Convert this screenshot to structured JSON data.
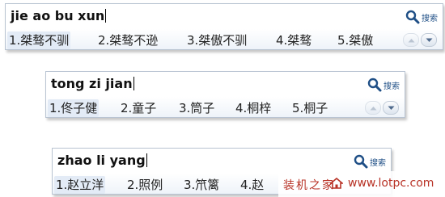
{
  "panels": [
    {
      "pinyin": "jie ao bu xun",
      "search_label": "搜索",
      "candidates": [
        "1.桀骜不驯",
        "2.桀骜不逊",
        "3.桀傲不驯",
        "4.桀骜",
        "5.桀傲"
      ]
    },
    {
      "pinyin": "tong zi jian",
      "search_label": "搜索",
      "candidates": [
        "1.佟子健",
        "2.童子",
        "3.筒子",
        "4.桐梓",
        "5.桐子"
      ]
    },
    {
      "pinyin": "zhao li yang",
      "search_label": "搜索",
      "candidates": [
        "1.赵立洋",
        "2.照例",
        "3.笊篱",
        "4.赵"
      ]
    }
  ],
  "watermark": {
    "text": "装机之家",
    "url": "www.lotpc.com"
  },
  "icons": {
    "search": "magnifier-icon",
    "page_up": "chevron-up-icon",
    "page_down": "chevron-down-icon"
  },
  "colors": {
    "selected_bg": "#e3ebf6",
    "search_icon": "#1f4f86",
    "watermark": "#b83226"
  }
}
